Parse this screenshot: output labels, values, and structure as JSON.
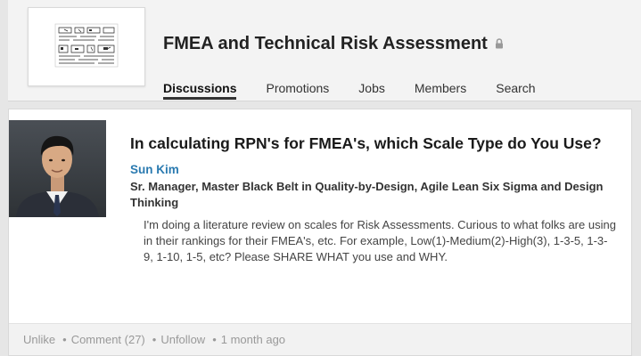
{
  "group": {
    "title": "FMEA and Technical Risk Assessment",
    "nav": [
      "Discussions",
      "Promotions",
      "Jobs",
      "Members",
      "Search"
    ],
    "active_tab": "Discussions"
  },
  "post": {
    "title": "In calculating RPN's for FMEA's, which Scale Type do You Use?",
    "author_name": "Sun Kim",
    "author_headline": "Sr. Manager, Master Black Belt in Quality-by-Design, Agile Lean Six Sigma and Design Thinking",
    "body": "I'm doing a literature review on scales for Risk Assessments. Curious to what folks are using in their rankings for their FMEA's, etc. For example, Low(1)-Medium(2)-High(3), 1-3-5, 1-3-9, 1-10, 1-5, etc? Please SHARE WHAT you use and WHY."
  },
  "actions": {
    "unlike": "Unlike",
    "comment": "Comment (27)",
    "unfollow": "Unfollow",
    "timestamp": "1 month ago",
    "separator": "•"
  },
  "icons": {
    "lock": "lock-icon"
  },
  "colors": {
    "author_link": "#2a7ab0",
    "page_bg": "#e6e6e6"
  }
}
